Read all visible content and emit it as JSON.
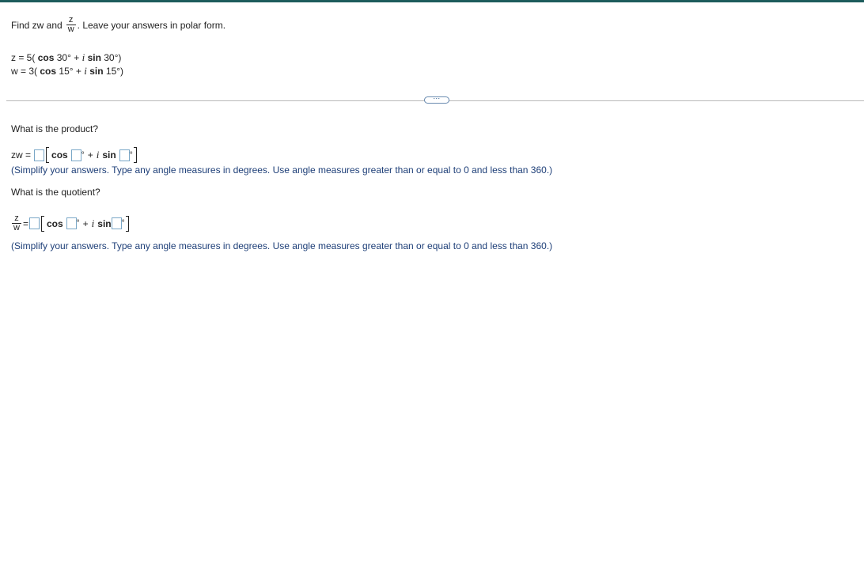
{
  "problem": {
    "find_prefix": "Find zw and",
    "frac_num": "z",
    "frac_den": "w",
    "find_suffix": ". Leave your answers in polar form."
  },
  "given": {
    "z_prefix": "z = 5(",
    "z_cos": "cos",
    "z_angle1": "30°",
    "plus": "+",
    "i": "i",
    "z_sin": "sin",
    "z_angle2": "30°)",
    "w_prefix": "w = 3(",
    "w_cos": "cos",
    "w_angle1": "15°",
    "w_sin": "sin",
    "w_angle2": "15°)"
  },
  "more_button": {
    "label": "⋯"
  },
  "product": {
    "question": "What is the product?",
    "lhs": "zw =",
    "cos": "cos",
    "deg": "°",
    "plus": "+",
    "i": "i",
    "sin": "sin",
    "note": "(Simplify your answers. Type any angle measures in degrees. Use angle measures greater than or equal to 0 and less than 360.)"
  },
  "quotient": {
    "question": "What is the quotient?",
    "frac_num": "z",
    "frac_den": "w",
    "eq": "=",
    "cos": "cos",
    "deg": "°",
    "plus": "+",
    "i": "i",
    "sin": "sin",
    "note": "(Simplify your answers. Type any angle measures in degrees. Use angle measures greater than or equal to 0 and less than 360.)"
  },
  "colors": {
    "top_bar": "#1d5c5c",
    "note_text": "#1e3f78",
    "input_border": "#7aa7c7"
  }
}
